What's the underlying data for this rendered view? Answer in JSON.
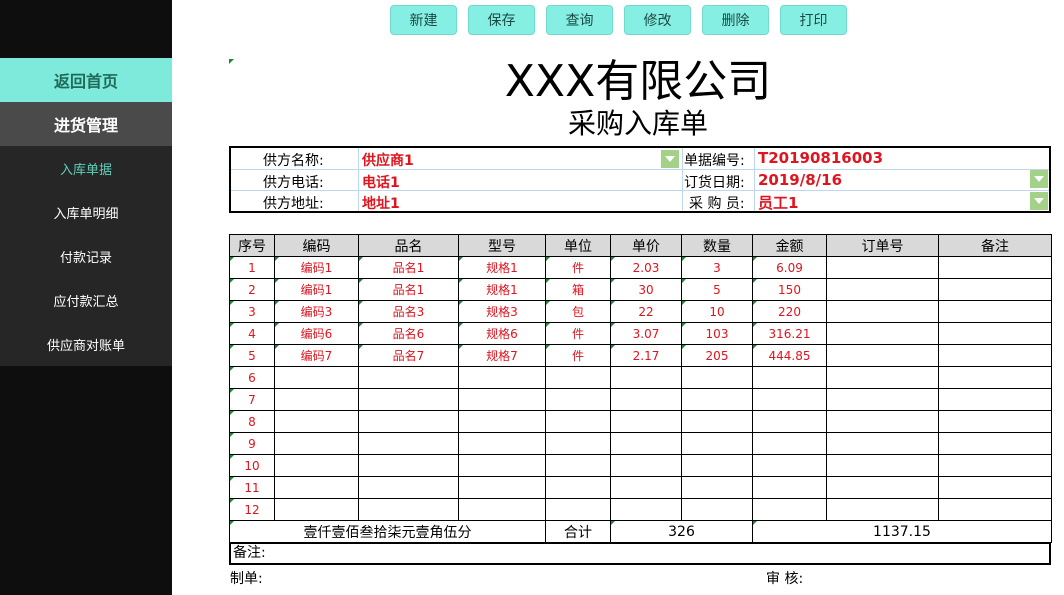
{
  "sidebar": {
    "home": "返回首页",
    "purchase": "进货管理",
    "items": [
      "入库单据",
      "入库单明细",
      "付款记录",
      "应付款汇总",
      "供应商对账单"
    ]
  },
  "toolbar": {
    "new": "新建",
    "save": "保存",
    "query": "查询",
    "edit": "修改",
    "delete": "删除",
    "print": "打印"
  },
  "header": {
    "company": "XXX有限公司",
    "title": "采购入库单"
  },
  "info": {
    "supplier_name_label": "供方名称:",
    "supplier_name": "供应商1",
    "supplier_phone_label": "供方电话:",
    "supplier_phone": "电话1",
    "supplier_addr_label": "供方地址:",
    "supplier_addr": "地址1",
    "doc_no_label": "单据编号:",
    "doc_no": "T20190816003",
    "order_date_label": "订货日期:",
    "order_date": "2019/8/16",
    "buyer_label": "采 购 员:",
    "buyer": "员工1"
  },
  "table": {
    "headers": [
      "序号",
      "编码",
      "品名",
      "型号",
      "单位",
      "单价",
      "数量",
      "金额",
      "订单号",
      "备注"
    ],
    "rows": [
      [
        "1",
        "编码1",
        "品名1",
        "规格1",
        "件",
        "2.03",
        "3",
        "6.09",
        "",
        ""
      ],
      [
        "2",
        "编码1",
        "品名1",
        "规格1",
        "箱",
        "30",
        "5",
        "150",
        "",
        ""
      ],
      [
        "3",
        "编码3",
        "品名3",
        "规格3",
        "包",
        "22",
        "10",
        "220",
        "",
        ""
      ],
      [
        "4",
        "编码6",
        "品名6",
        "规格6",
        "件",
        "3.07",
        "103",
        "316.21",
        "",
        ""
      ],
      [
        "5",
        "编码7",
        "品名7",
        "规格7",
        "件",
        "2.17",
        "205",
        "444.85",
        "",
        ""
      ],
      [
        "6",
        "",
        "",
        "",
        "",
        "",
        "",
        "",
        "",
        ""
      ],
      [
        "7",
        "",
        "",
        "",
        "",
        "",
        "",
        "",
        "",
        ""
      ],
      [
        "8",
        "",
        "",
        "",
        "",
        "",
        "",
        "",
        "",
        ""
      ],
      [
        "9",
        "",
        "",
        "",
        "",
        "",
        "",
        "",
        "",
        ""
      ],
      [
        "10",
        "",
        "",
        "",
        "",
        "",
        "",
        "",
        "",
        ""
      ],
      [
        "11",
        "",
        "",
        "",
        "",
        "",
        "",
        "",
        "",
        ""
      ],
      [
        "12",
        "",
        "",
        "",
        "",
        "",
        "",
        "",
        "",
        ""
      ]
    ],
    "total_words": "壹仟壹佰叁拾柒元壹角伍分",
    "total_label": "合计",
    "total_qty": "326",
    "total_amount": "1137.15"
  },
  "footer": {
    "remark": "备注:",
    "maker": "制单:",
    "audit": "审 核:"
  },
  "colors": {
    "sidebar_bg": "#0e0e0e",
    "accent": "#86efe3",
    "value_red": "#e0141e"
  }
}
